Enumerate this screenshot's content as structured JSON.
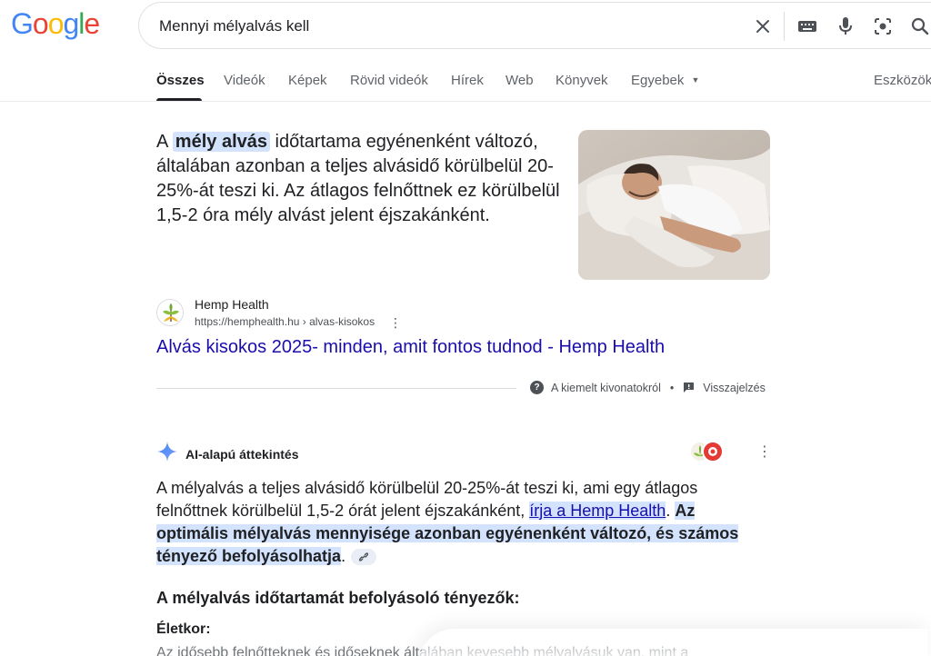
{
  "logo": {
    "letters": [
      "G",
      "o",
      "o",
      "g",
      "l",
      "e"
    ],
    "colors": [
      "#4285F4",
      "#EA4335",
      "#FBBC05",
      "#4285F4",
      "#34A853",
      "#EA4335"
    ]
  },
  "search": {
    "query": "Mennyi mélyalvás kell"
  },
  "tabs": [
    {
      "label": "Összes",
      "active": true
    },
    {
      "label": "Videók"
    },
    {
      "label": "Képek"
    },
    {
      "label": "Rövid videók"
    },
    {
      "label": "Hírek"
    },
    {
      "label": "Web"
    },
    {
      "label": "Könyvek"
    },
    {
      "label": "Egyebek"
    }
  ],
  "tools_label": "Eszközök",
  "snippet": {
    "prefix": "A ",
    "highlight": "mély alvás",
    "rest": " időtartama egyénenként változó, általában azonban a teljes alvásidő körülbelül 20-25%-át teszi ki. Az átlagos felnőttnek ez körülbelül 1,5-2 óra mély alvást jelent éjszakánként."
  },
  "source": {
    "name": "Hemp Health",
    "url": "https://hemphealth.hu › alvas-kisokos",
    "title": "Alvás kisokos 2025- minden, amit fontos tudnod - Hemp Health"
  },
  "meta": {
    "about": "A kiemelt kivonatokról",
    "feedback": "Visszajelzés"
  },
  "ai": {
    "title": "AI-alapú áttekintés",
    "p1": "A mélyalvás a teljes alvásidő körülbelül 20-25%-át teszi ki, ami egy átlagos felnőttnek körülbelül 1,5-2 órát jelent éjszakánként, ",
    "link": "írja a Hemp Health",
    "p1_end": ". ",
    "bold": "Az optimális mélyalvás mennyisége azonban egyénenként változó, és számos tényező befolyásolhatja",
    "p2_end": ".",
    "subheading": "A mélyalvás időtartamát befolyásoló tényezők:",
    "label": "Életkor:",
    "cut_text": "Az idősebb felnőtteknek és időseknek általában kevesebb mélyalvásuk van, mint a"
  },
  "colors": {
    "link": "#1a0dab",
    "highlight": "#d3e3fd",
    "text": "#202124",
    "muted": "#5f6368"
  }
}
